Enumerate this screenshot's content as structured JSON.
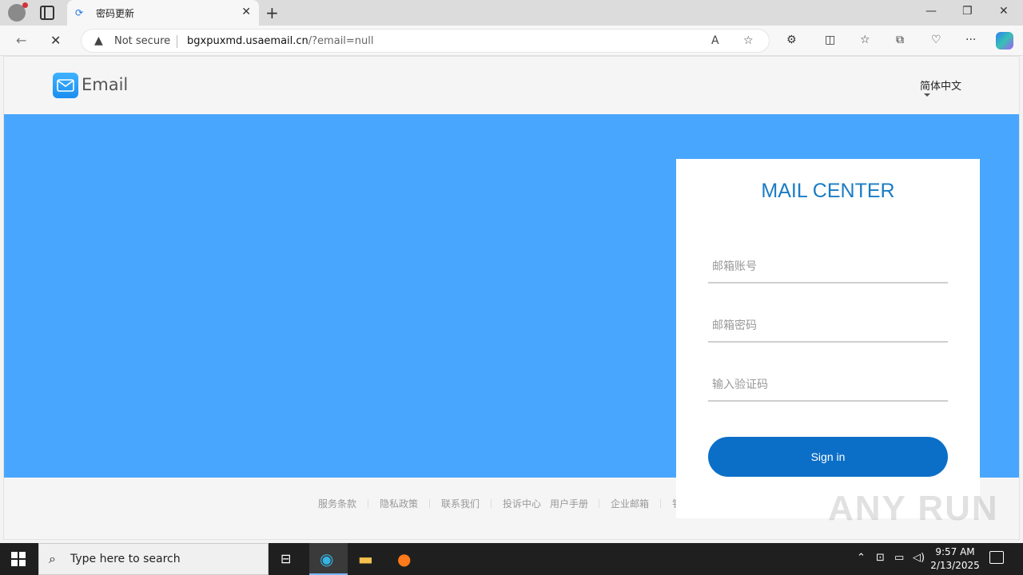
{
  "browser": {
    "tab_title": "密码更新",
    "tab_favicon": "loading-icon",
    "address": {
      "security_label": "Not secure",
      "host": "bgxpuxmd.usaemail.cn",
      "path": "/?email=null"
    }
  },
  "site": {
    "logo_text": "Email",
    "language": "简体中文",
    "login": {
      "title": "MAIL CENTER",
      "account_placeholder": "邮箱账号",
      "password_placeholder": "邮箱密码",
      "captcha_placeholder": "输入验证码",
      "signin_label": "Sign in"
    },
    "footer_links": [
      "服务条款",
      "隐私政策",
      "联系我们",
      "投诉中心",
      "用户手册",
      "企业邮箱",
      "钅"
    ],
    "colors": {
      "banner": "#48a6fe",
      "title": "#1a7cc4",
      "button": "#0b6fc8"
    }
  },
  "watermark": "ANY RUN",
  "taskbar": {
    "search_placeholder": "Type here to search",
    "time": "9:57 AM",
    "date": "2/13/2025"
  }
}
